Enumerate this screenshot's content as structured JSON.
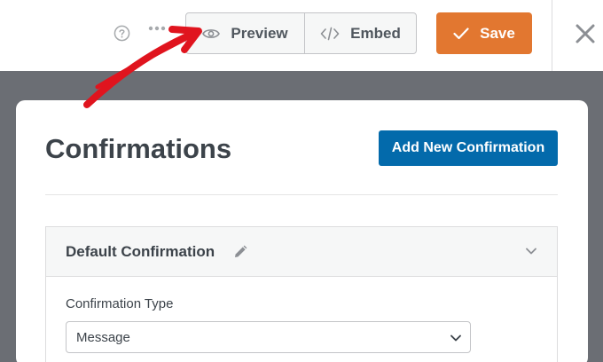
{
  "toolbar": {
    "preview_label": "Preview",
    "embed_label": "Embed",
    "save_label": "Save",
    "help_icon": "help-circle-icon",
    "more_icon": "more-dots-icon",
    "close_icon": "close-icon"
  },
  "panel": {
    "title": "Confirmations",
    "add_button_label": "Add New Confirmation",
    "confirmation": {
      "title": "Default Confirmation",
      "field_label": "Confirmation Type",
      "select_value": "Message"
    }
  },
  "colors": {
    "save_button": "#e27730",
    "add_button": "#036aab",
    "backdrop": "#6b6e74",
    "annotation_arrow": "#e0141e"
  }
}
